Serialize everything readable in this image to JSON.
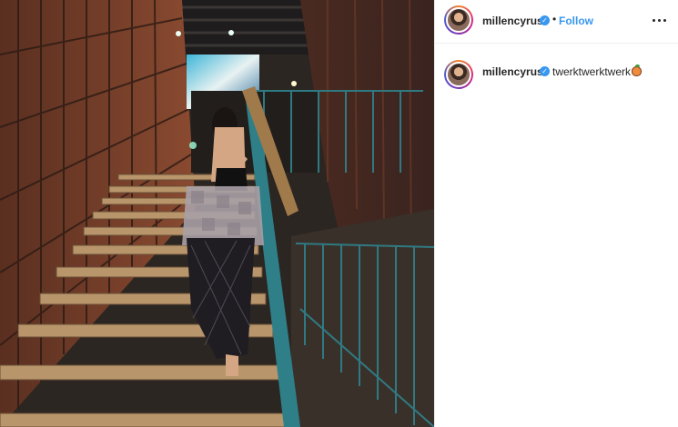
{
  "post": {
    "username": "millencyrus",
    "verified_icon": "verified-badge-icon",
    "separator": "•",
    "follow_label": "Follow",
    "more_icon": "more-options-icon"
  },
  "caption": {
    "username": "millencyrus",
    "text": "twerktwerktwerk",
    "emoji_icon": "peach-emoji-icon"
  },
  "colors": {
    "link_blue": "#3897f0",
    "text": "#262626",
    "border": "#efefef"
  }
}
